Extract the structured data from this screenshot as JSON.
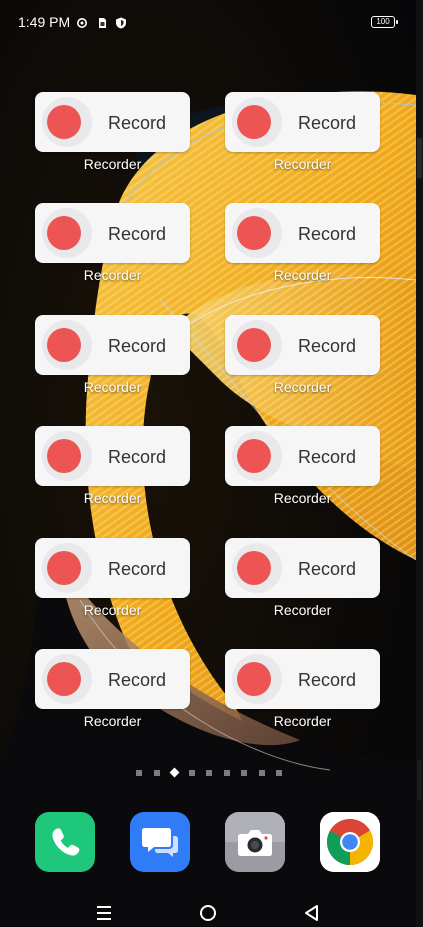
{
  "status_bar": {
    "time": "1:49 PM",
    "icons": [
      "settings-gear-icon",
      "sim-card-icon",
      "shield-icon"
    ],
    "battery": "100"
  },
  "home": {
    "widgets": [
      {
        "button": "Record",
        "caption": "Recorder"
      },
      {
        "button": "Record",
        "caption": "Recorder"
      },
      {
        "button": "Record",
        "caption": "Recorder"
      },
      {
        "button": "Record",
        "caption": "Recorder"
      },
      {
        "button": "Record",
        "caption": "Recorder"
      },
      {
        "button": "Record",
        "caption": "Recorder"
      },
      {
        "button": "Record",
        "caption": "Recorder"
      },
      {
        "button": "Record",
        "caption": "Recorder"
      },
      {
        "button": "Record",
        "caption": "Recorder"
      },
      {
        "button": "Record",
        "caption": "Recorder"
      },
      {
        "button": "Record",
        "caption": "Recorder"
      },
      {
        "button": "Record",
        "caption": "Recorder"
      }
    ],
    "page_indicator": {
      "pages": 9,
      "current": 2
    }
  },
  "dock": {
    "apps": [
      {
        "icon": "phone-icon",
        "color": "#1ec77a"
      },
      {
        "icon": "messages-icon",
        "color": "#2f7cf6"
      },
      {
        "icon": "camera-icon",
        "color": "#9a9ba3"
      },
      {
        "icon": "chrome-icon",
        "color": "#ffffff"
      }
    ]
  },
  "nav_bar": {
    "buttons": [
      "menu-icon",
      "home-icon",
      "back-icon"
    ]
  },
  "colors": {
    "record_red": "#ed5555",
    "widget_bg": "#f6f6f7",
    "wallpaper_gold": "#f2b72a"
  }
}
